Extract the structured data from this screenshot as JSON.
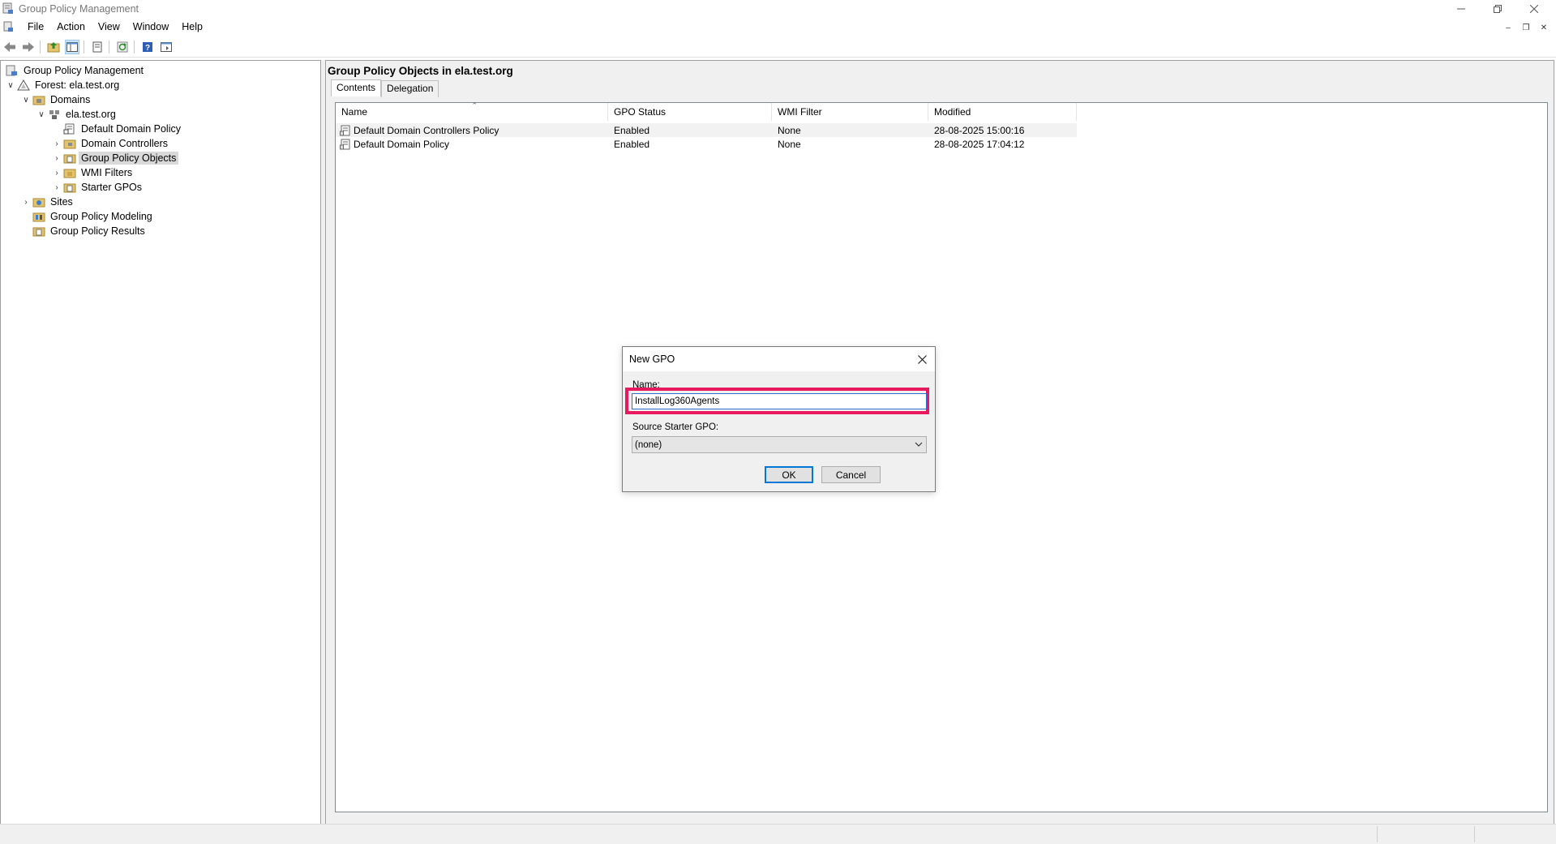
{
  "window": {
    "title": "Group Policy Management"
  },
  "menubar": {
    "items": [
      "File",
      "Action",
      "View",
      "Window",
      "Help"
    ]
  },
  "toolbar": {
    "icons": [
      "back-arrow-icon",
      "forward-arrow-icon",
      "up-folder-icon",
      "show-hide-tree-icon",
      "properties-icon",
      "refresh-icon",
      "help-icon",
      "console-tree-icon"
    ]
  },
  "tree": {
    "root": "Group Policy Management",
    "forest": "Forest: ela.test.org",
    "domains": "Domains",
    "domain": "ela.test.org",
    "default_domain_policy": "Default Domain Policy",
    "domain_controllers": "Domain Controllers",
    "group_policy_objects": "Group Policy Objects",
    "wmi_filters": "WMI Filters",
    "starter_gpos": "Starter GPOs",
    "sites": "Sites",
    "modeling": "Group Policy Modeling",
    "results": "Group Policy Results"
  },
  "right_pane": {
    "heading": "Group Policy Objects in ela.test.org",
    "tabs": [
      "Contents",
      "Delegation"
    ],
    "active_tab": "Contents",
    "columns": [
      "Name",
      "GPO Status",
      "WMI Filter",
      "Modified"
    ],
    "rows": [
      {
        "name": "Default Domain Controllers Policy",
        "status": "Enabled",
        "wmi": "None",
        "modified": "28-08-2025 15:00:16"
      },
      {
        "name": "Default Domain Policy",
        "status": "Enabled",
        "wmi": "None",
        "modified": "28-08-2025 17:04:12"
      }
    ]
  },
  "dialog": {
    "title": "New GPO",
    "name_label": "Name:",
    "name_value": "InstallLog360Agents",
    "source_label": "Source Starter GPO:",
    "source_value": "(none)",
    "ok_label": "OK",
    "cancel_label": "Cancel",
    "highlight_color": "#e8195f"
  }
}
